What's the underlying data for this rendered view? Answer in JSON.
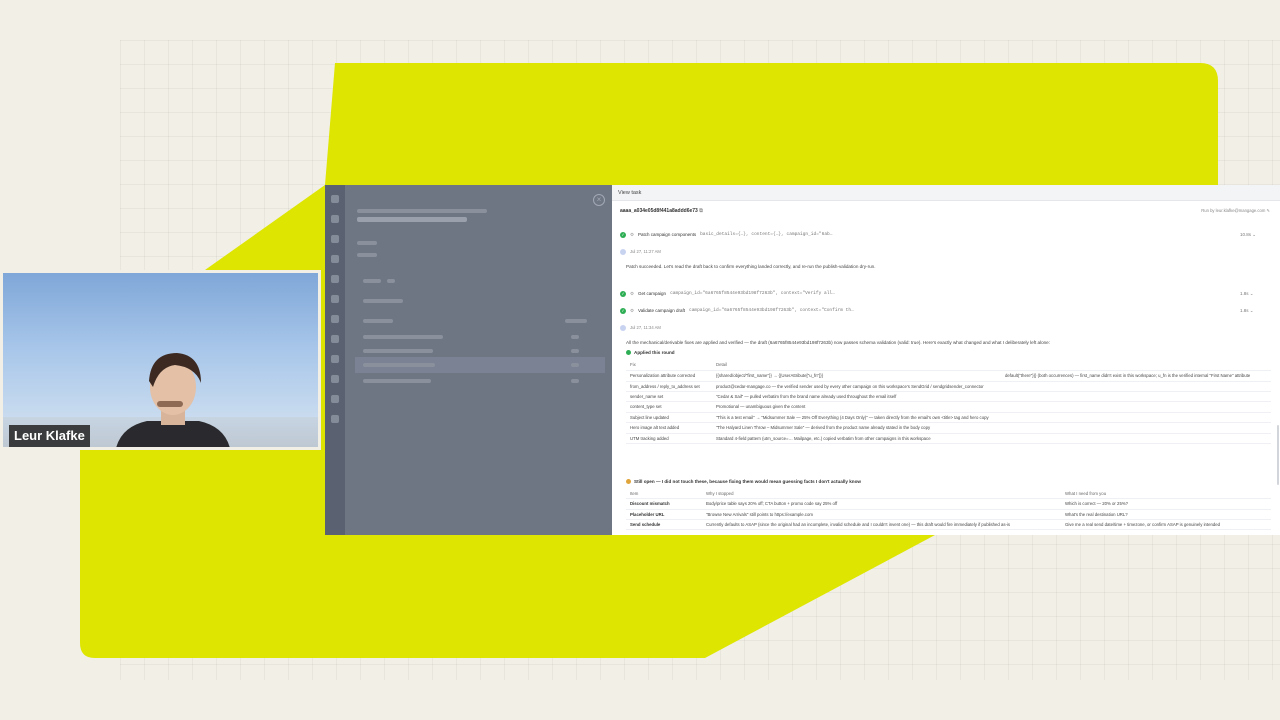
{
  "presenter": {
    "name": "Leur Klafke"
  },
  "task_panel": {
    "header_title": "View task",
    "task_id": "aaaa_a034e05d8f441a8addd6e73",
    "run_by": "Run by leur.klafke@mangage.com",
    "tool_calls": [
      {
        "label": "Patch campaign components",
        "args": "basic_details={…}, content={…}, campaign_id=\"6ab…",
        "meta": "10.8s"
      },
      {
        "label": "Get campaign",
        "args": "campaign_id=\"6a6765f8544e93bd198f7263b\", context=\"Verify all…",
        "meta": "1.8s"
      },
      {
        "label": "Validate campaign draft",
        "args": "campaign_id=\"6a6765f8544e93bd198f7263b\", context=\"Confirm th…",
        "meta": "1.8s"
      }
    ],
    "timestamps": [
      "Jul 27, 11:27 AM",
      "Jul 27, 11:34 AM"
    ],
    "message_1": "Patch succeeded. Let's read the draft back to confirm everything landed correctly, and re-run the publish-validation dry-run.",
    "message_2": "All the mechanical/derivable fixes are applied and verified — the draft (6a6765f8544e93bd198f7263b) now passes schema validation (valid: true). Here's exactly what changed and what I deliberately left alone:",
    "applied_heading": "Applied this round",
    "fixes_headers": [
      "Fix",
      "Detail",
      ""
    ],
    "fixes": [
      [
        "Personalization attribute corrected",
        "{{shared/object/\"first_name\"}} → {{UserAttribute[\"u_fn\"]}}",
        "default(\"there\")}} (both occurrences) — first_name didn't exist in this workspace; u_fn is the verified internal \"First Name\" attribute"
      ],
      [
        "from_address / reply_to_address set",
        "product@cedar-mangage.co — the verified sender used by every other campaign on this workspace's SendGrid / sendgridsender_connector",
        ""
      ],
      [
        "sender_name set",
        "\"Cedar & Sail\" — pulled verbatim from the brand name already used throughout the email itself",
        ""
      ],
      [
        "content_type set",
        "Promotional — unambiguous given the content",
        ""
      ],
      [
        "Subject line updated",
        "\"This is a test email\" → \"Midsummer Sale — 25% Off Everything (4 Days Only)\" — taken directly from the email's own <title> tag and hero copy",
        ""
      ],
      [
        "Hero image alt text added",
        "\"The Halyard Linen Throw – Midsummer Sale\" — derived from the product name already stated in the body copy",
        ""
      ],
      [
        "UTM tracking added",
        "Standard 4-field pattern (utm_source=… Mailpage, etc.) copied verbatim from other campaigns in this workspace",
        ""
      ]
    ],
    "open_heading": "Still open — I did not touch these, because fixing them would mean guessing facts I don't actually know",
    "open_headers": [
      "Item",
      "Why I stopped",
      "What I need from you"
    ],
    "open_items": [
      [
        "Discount mismatch",
        "Body/price table says 20% off; CTA button + promo code say 25% off",
        "Which is correct — 20% or 25%?"
      ],
      [
        "Placeholder URL",
        "\"Browse New Arrivals\" still points to https://example.com",
        "What's the real destination URL?"
      ],
      [
        "Send schedule",
        "Currently defaults to ASAP (since the original had an incomplete, invalid schedule and I couldn't invent one) — this draft would fire immediately if published as-is",
        "Give me a real send date/time + timezone, or confirm ASAP is genuinely intended"
      ]
    ]
  },
  "colors": {
    "lime": "#dde500",
    "background": "#f1efe6",
    "success": "#2eae54"
  }
}
